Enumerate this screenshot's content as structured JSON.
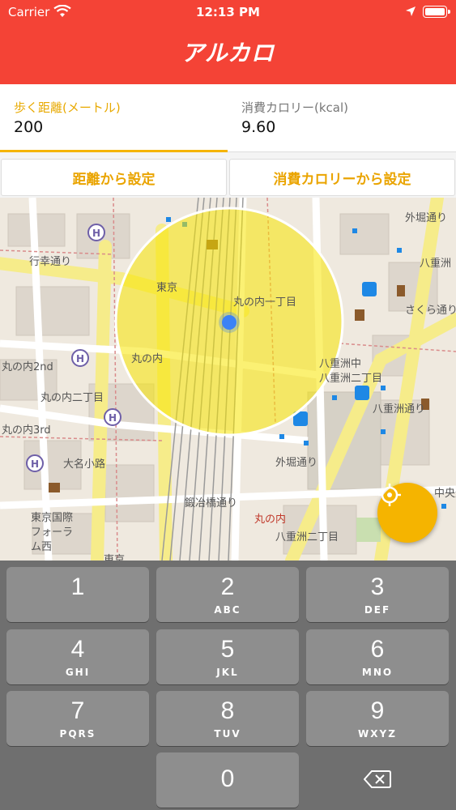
{
  "status": {
    "carrier": "Carrier",
    "time": "12:13 PM"
  },
  "app": {
    "title": "アルカロ"
  },
  "inputs": {
    "distance": {
      "label": "歩く距離(メートル)",
      "value": "200"
    },
    "calorie": {
      "label": "消費カロリー(kcal)",
      "value": "9.60"
    }
  },
  "buttons": {
    "set_by_distance": "距離から設定",
    "set_by_calorie": "消費カロリーから設定"
  },
  "map": {
    "labels": [
      "行幸通り",
      "東京",
      "丸の内一丁目",
      "丸の内",
      "丸の内2nd",
      "丸の内二丁目",
      "丸の内3rd",
      "大名小路",
      "東京国際",
      "フォーラ",
      "ム西",
      "八重洲中",
      "八重洲二丁目",
      "外堀通り",
      "八重洲",
      "さくら通り",
      "八重洲通り",
      "外堀通り",
      "中央通り",
      "八重洲二丁目",
      "東京",
      "丸の内",
      "鍛冶橋通り"
    ],
    "accent_color": "#f5b400",
    "circle_color": "#f7e600",
    "user_dot_color": "#3b82f6"
  },
  "keypad": {
    "keys": [
      {
        "num": "1",
        "sub": ""
      },
      {
        "num": "2",
        "sub": "ABC"
      },
      {
        "num": "3",
        "sub": "DEF"
      },
      {
        "num": "4",
        "sub": "GHI"
      },
      {
        "num": "5",
        "sub": "JKL"
      },
      {
        "num": "6",
        "sub": "MNO"
      },
      {
        "num": "7",
        "sub": "PQRS"
      },
      {
        "num": "8",
        "sub": "TUV"
      },
      {
        "num": "9",
        "sub": "WXYZ"
      },
      {
        "num": "0",
        "sub": ""
      }
    ],
    "delete_icon": "backspace-icon"
  }
}
